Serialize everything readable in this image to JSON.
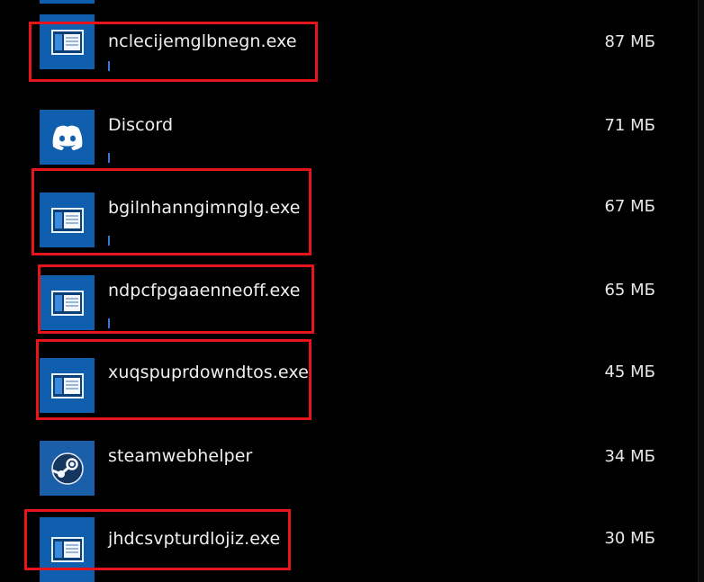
{
  "colors": {
    "background": "#000000",
    "tile": "#0f5fae",
    "highlight": "#e8141b",
    "text": "#f0f0f0",
    "progress": "#3a78d8"
  },
  "processes": [
    {
      "name": "nclecijemglbnegn.exe",
      "size": "87 МБ",
      "icon": "app-window-icon",
      "highlighted": true
    },
    {
      "name": "Discord",
      "size": "71 МБ",
      "icon": "discord-icon",
      "highlighted": false
    },
    {
      "name": "bgilnhanngimnglg.exe",
      "size": "67 МБ",
      "icon": "app-window-icon",
      "highlighted": true
    },
    {
      "name": "ndpcfpgaaenneoff.exe",
      "size": "65 МБ",
      "icon": "app-window-icon",
      "highlighted": true
    },
    {
      "name": "xuqspuprdowndtos.exe",
      "size": "45 МБ",
      "icon": "app-window-icon",
      "highlighted": true
    },
    {
      "name": "steamwebhelper",
      "size": "34 МБ",
      "icon": "steam-icon",
      "highlighted": false
    },
    {
      "name": "jhdcsvpturdlojiz.exe",
      "size": "30 МБ",
      "icon": "app-window-icon",
      "highlighted": true
    }
  ]
}
